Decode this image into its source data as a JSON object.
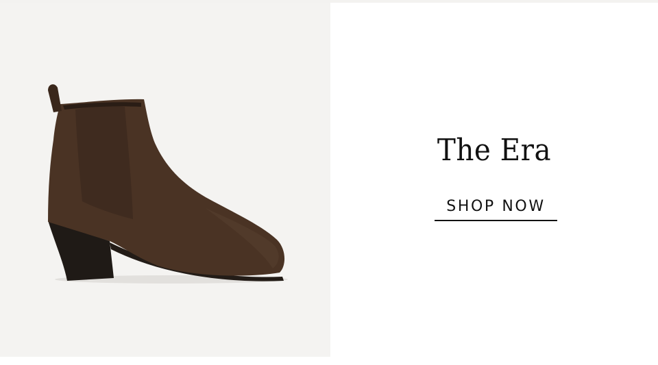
{
  "hero": {
    "title": "The Era",
    "cta_label": "SHOP NOW"
  },
  "product_image": {
    "icon": "ankle-boot-image",
    "colors": {
      "panel_background": "#f4f3f1",
      "suede": "#4a3324",
      "suede_shadow": "#3a271b",
      "heel": "#1f1a16"
    }
  }
}
